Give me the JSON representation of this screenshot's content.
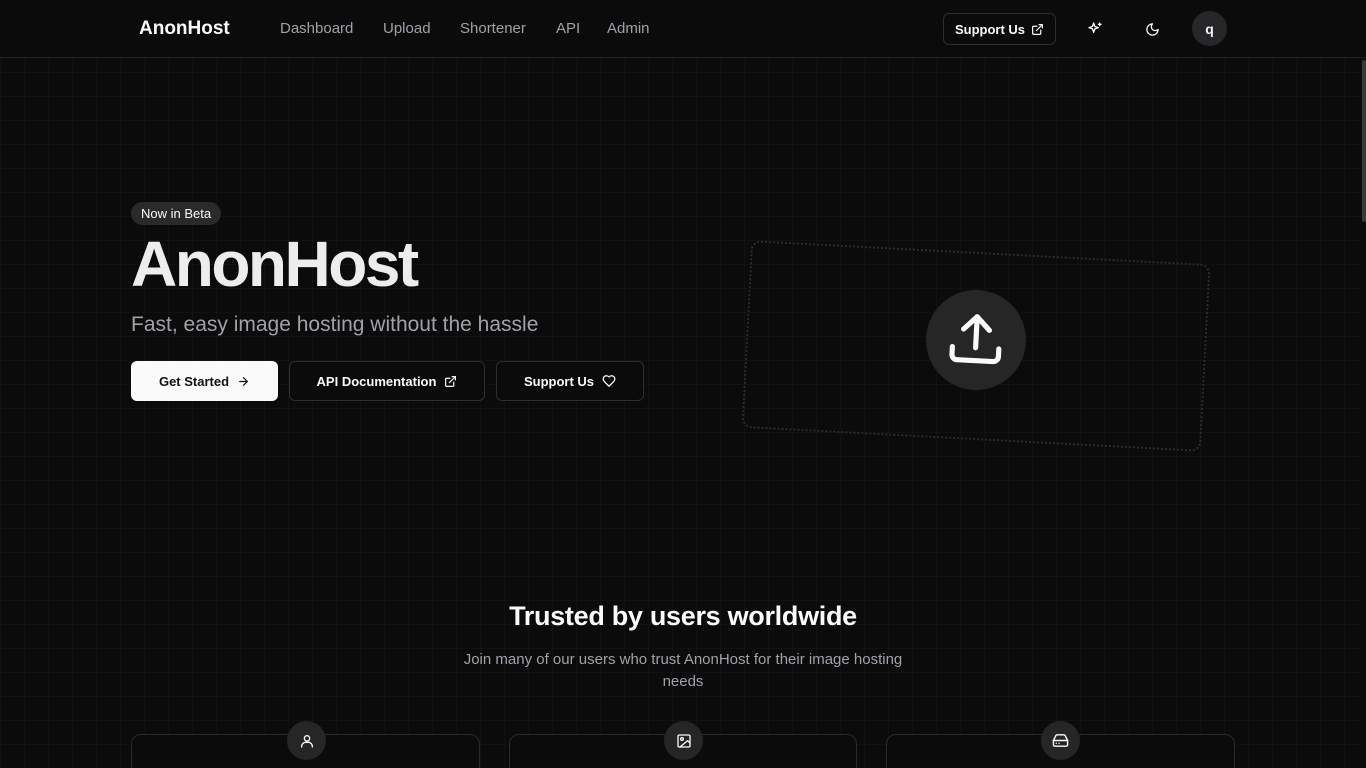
{
  "nav": {
    "brand": "AnonHost",
    "links": [
      "Dashboard",
      "Upload",
      "Shortener",
      "API",
      "Admin"
    ],
    "support_label": "Support Us",
    "avatar_initial": "q"
  },
  "hero": {
    "badge": "Now in Beta",
    "title": "AnonHost",
    "subtitle": "Fast, easy image hosting without the hassle",
    "buttons": {
      "get_started": "Get Started",
      "api_docs": "API Documentation",
      "support": "Support Us"
    }
  },
  "trusted": {
    "title": "Trusted by users worldwide",
    "description": "Join many of our users who trust AnonHost for their image hosting needs"
  },
  "icons": {
    "support_nav": "external-link-icon",
    "sparkles": "sparkles-icon",
    "theme": "moon-icon",
    "get_started": "arrow-right-icon",
    "api_docs": "external-link-icon",
    "support": "heart-icon",
    "upload": "upload-icon",
    "stat1": "user-icon",
    "stat2": "image-icon",
    "stat3": "hard-drive-icon"
  },
  "colors": {
    "background": "#0b0b0b",
    "primary_button": "#fafafa",
    "muted_text": "#a1a1aa"
  }
}
